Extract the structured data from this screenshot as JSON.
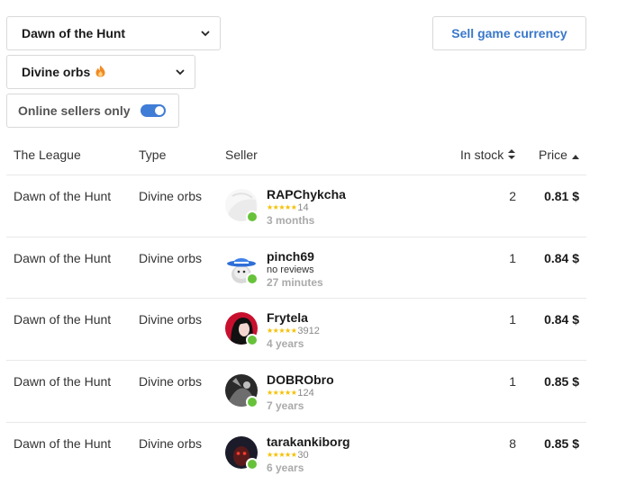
{
  "filters": {
    "game": "Dawn of the Hunt",
    "currency": "Divine orbs",
    "online_label": "Online sellers only",
    "online_enabled": true
  },
  "sell_button": "Sell game currency",
  "columns": {
    "league": "The League",
    "type": "Type",
    "seller": "Seller",
    "stock": "In stock",
    "price": "Price"
  },
  "rows": [
    {
      "league": "Dawn of the Hunt",
      "type": "Divine orbs",
      "seller": "RAPChykcha",
      "stars": "★★★★★",
      "reviews": "14",
      "no_reviews": "",
      "age": "3 months",
      "stock": "2",
      "price": "0.81 $",
      "online": true
    },
    {
      "league": "Dawn of the Hunt",
      "type": "Divine orbs",
      "seller": "pinch69",
      "stars": "",
      "reviews": "",
      "no_reviews": "no reviews",
      "age": "27 minutes",
      "stock": "1",
      "price": "0.84 $",
      "online": true
    },
    {
      "league": "Dawn of the Hunt",
      "type": "Divine orbs",
      "seller": "Frytela",
      "stars": "★★★★★",
      "reviews": "3912",
      "no_reviews": "",
      "age": "4 years",
      "stock": "1",
      "price": "0.84 $",
      "online": true
    },
    {
      "league": "Dawn of the Hunt",
      "type": "Divine orbs",
      "seller": "DOBRObro",
      "stars": "★★★★★",
      "reviews": "124",
      "no_reviews": "",
      "age": "7 years",
      "stock": "1",
      "price": "0.85 $",
      "online": true
    },
    {
      "league": "Dawn of the Hunt",
      "type": "Divine orbs",
      "seller": "tarakankiborg",
      "stars": "★★★★★",
      "reviews": "30",
      "no_reviews": "",
      "age": "6 years",
      "stock": "8",
      "price": "0.85 $",
      "online": true
    }
  ],
  "colors": {
    "accent": "#3a78c9",
    "online_dot": "#67c23a",
    "star": "#f5c000",
    "fire": "#f08a24"
  }
}
